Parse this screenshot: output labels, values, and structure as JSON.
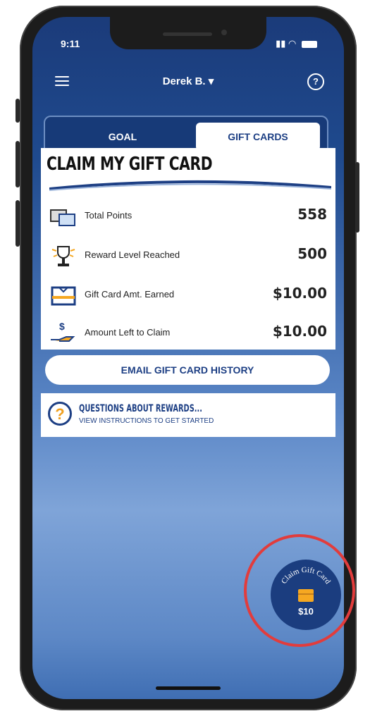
{
  "status_bar": {
    "time": "9:11",
    "signal_icon": "signal-icon",
    "wifi_icon": "wifi-icon",
    "battery_icon": "battery-icon"
  },
  "header": {
    "user_name": "Derek B. ▾",
    "menu_icon": "menu-icon",
    "help_icon": "help-icon",
    "help_glyph": "?"
  },
  "tabs": [
    {
      "label": "GOAL",
      "active": false
    },
    {
      "label": "GIFT CARDS",
      "active": true
    }
  ],
  "card": {
    "title": "CLAIM MY GIFT CARD",
    "rows": [
      {
        "label": "Total Points",
        "value": "558",
        "icon": "cards-icon"
      },
      {
        "label": "Reward Level Reached",
        "value": "500",
        "icon": "trophy-icon"
      },
      {
        "label": "Gift Card Amt. Earned",
        "value": "$10.00",
        "icon": "gift-card-icon"
      },
      {
        "label": "Amount Left to Claim",
        "value": "$10.00",
        "icon": "money-hand-icon"
      }
    ]
  },
  "email_button": {
    "label": "EMAIL GIFT CARD HISTORY"
  },
  "questions": {
    "title": "QUESTIONS ABOUT REWARDS...",
    "subtitle": "VIEW INSTRUCTIONS TO GET STARTED",
    "icon_glyph": "?"
  },
  "claim_badge": {
    "arc_text": "Claim Gift Card",
    "amount": "$10"
  },
  "colors": {
    "navy": "#1d3f84",
    "accent_red": "#e23c3c",
    "gift_orange": "#f6a821"
  }
}
